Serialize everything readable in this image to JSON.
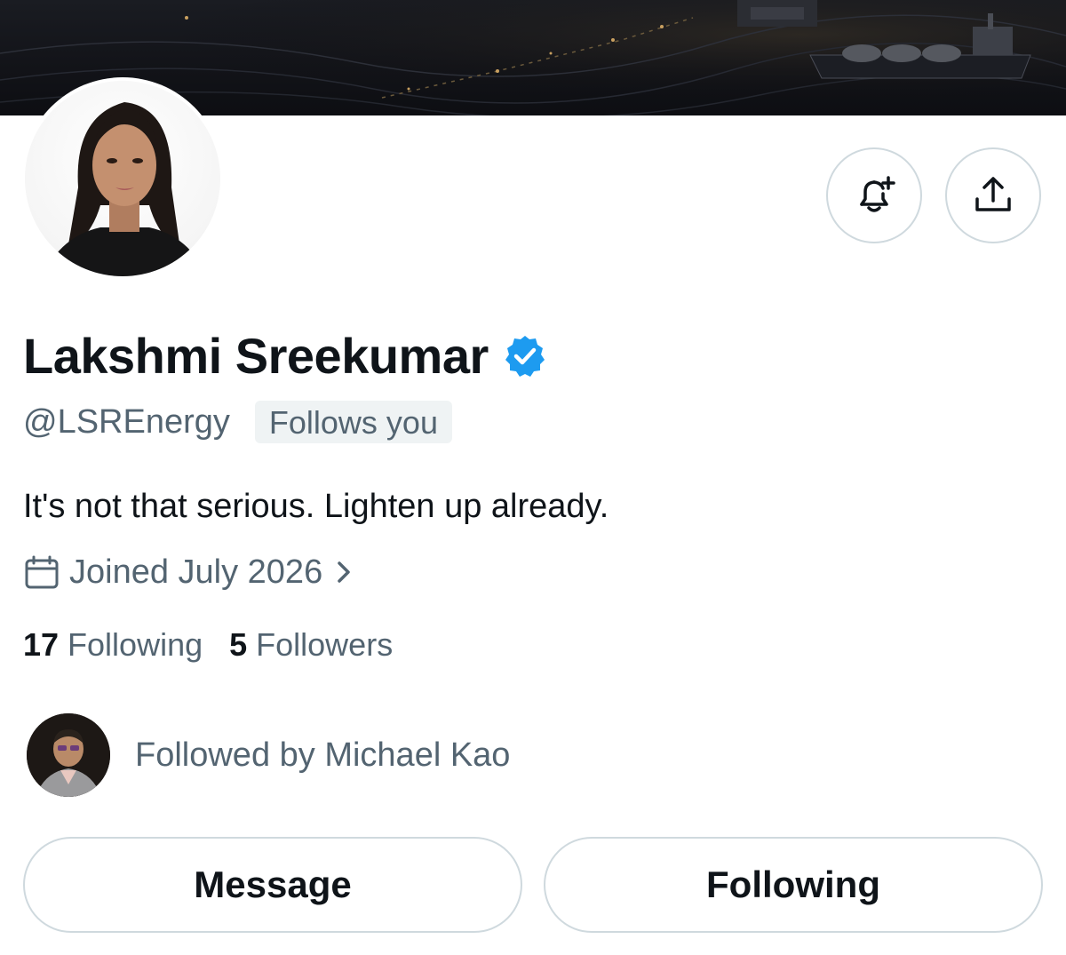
{
  "profile": {
    "display_name": "Lakshmi Sreekumar",
    "handle": "@LSREnergy",
    "follows_you_badge": "Follows you",
    "bio": "It's not that serious. Lighten up already.",
    "joined": "Joined July 2026",
    "verified": true
  },
  "stats": {
    "following_count": "17",
    "following_label": "Following",
    "followers_count": "5",
    "followers_label": "Followers"
  },
  "followed_by": {
    "text": "Followed by Michael Kao"
  },
  "actions": {
    "message_label": "Message",
    "following_label": "Following"
  },
  "icons": {
    "notify": "bell-plus-icon",
    "share": "share-icon",
    "calendar": "calendar-icon",
    "chevron": "chevron-right-icon",
    "verified": "verified-badge-icon"
  },
  "colors": {
    "text_primary": "#0f1419",
    "text_secondary": "#536471",
    "border": "#cfd9de",
    "verified_blue": "#1d9bf0",
    "badge_bg": "#eff3f4"
  }
}
